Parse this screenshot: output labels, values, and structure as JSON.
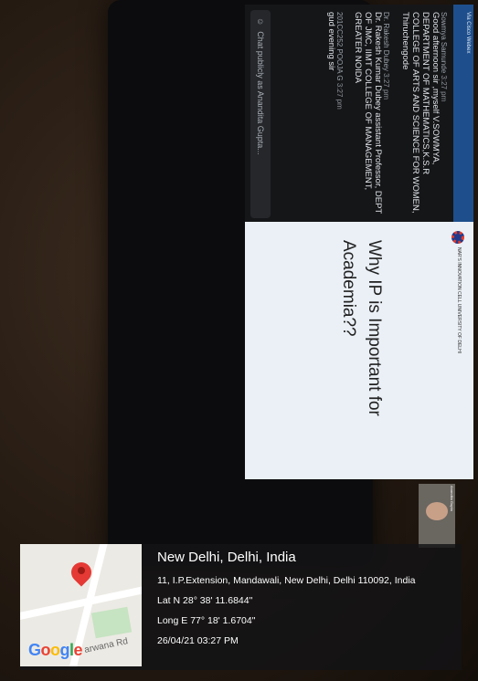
{
  "chat": {
    "header": "Via Cisco Webex",
    "messages": [
      {
        "name": "Sowmya Samunde",
        "time": "3:27 pm",
        "text": "Good afternoon sir ,myself V.SOWMYA, DEPARTMENT OF MATHEMATICS,K.S.R COLLEGE OF ARTS AND SCIENCE FOR WOMEN, Thiruchengode"
      },
      {
        "name": "Dr. Rakesh Dubey",
        "time": "3:27 pm",
        "text": "Dr. Rakesh Kumar Dubey assistant Professor, DEPT OF JMC, IIMT COLLEGE OF MANAGEMENT, GREATER NOIDA"
      },
      {
        "name": "201CC252 POOJA G",
        "time": "3:27 pm",
        "text": "gud evening sir"
      }
    ],
    "input_placeholder": "Chat publicly as Anandita Gupta..."
  },
  "slide": {
    "logo_text": "NAR'S INNOVATION CELL UNIVERSITY OF DELHI",
    "title_line1": "Why IP is Important for",
    "title_line2": "Academia??"
  },
  "webcam": {
    "label": "Anandita Gupta"
  },
  "geotag": {
    "city": "New Delhi, Delhi, India",
    "address": "11, I.P.Extension, Mandawali, New Delhi, Delhi 110092, India",
    "lat": "Lat N 28° 38' 11.6844\"",
    "long": "Long E 77° 18' 1.6704\"",
    "datetime": "26/04/21 03:27 PM",
    "map_road_label": "arwana Rd",
    "map_brand": "Google"
  },
  "colors": {
    "chat_header": "#1e4f8c",
    "slide_bg": "#eaf0f6",
    "pin": "#e53935"
  }
}
